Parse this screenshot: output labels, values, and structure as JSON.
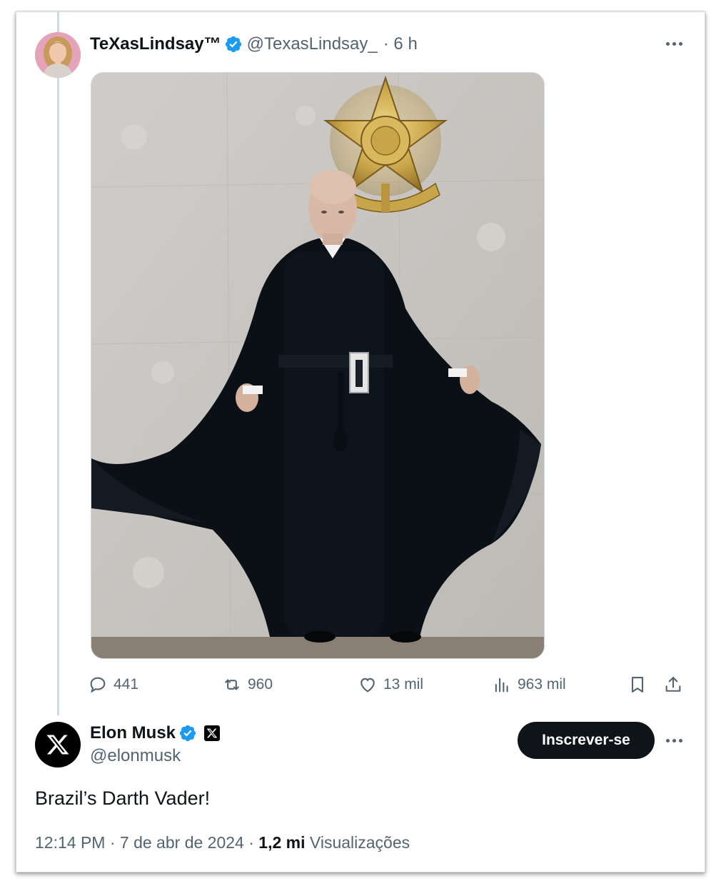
{
  "original_tweet": {
    "author_name": "TeXasLindsay™",
    "author_handle": "@TexasLindsay_",
    "time_ago": "· 6 h",
    "verified": true,
    "avatar_icon": "profile-photo-avatar",
    "media_description_icon": "photo-media"
  },
  "actions": {
    "replies": "441",
    "reposts": "960",
    "likes": "13 mil",
    "views": "963 mil"
  },
  "reply_tweet": {
    "author_name": "Elon Musk",
    "author_handle": "@elonmusk",
    "subscribe_label": "Inscrever-se",
    "text": "Brazil’s Darth Vader!",
    "time": "12:14 PM",
    "date": "7 de abr de 2024",
    "views_count": "1,2 mi",
    "views_label": "Visualizações"
  },
  "colors": {
    "verified_blue": "#1d9bf0",
    "text_primary": "#0f1419",
    "text_secondary": "#536471",
    "button_dark": "#0f1419"
  }
}
